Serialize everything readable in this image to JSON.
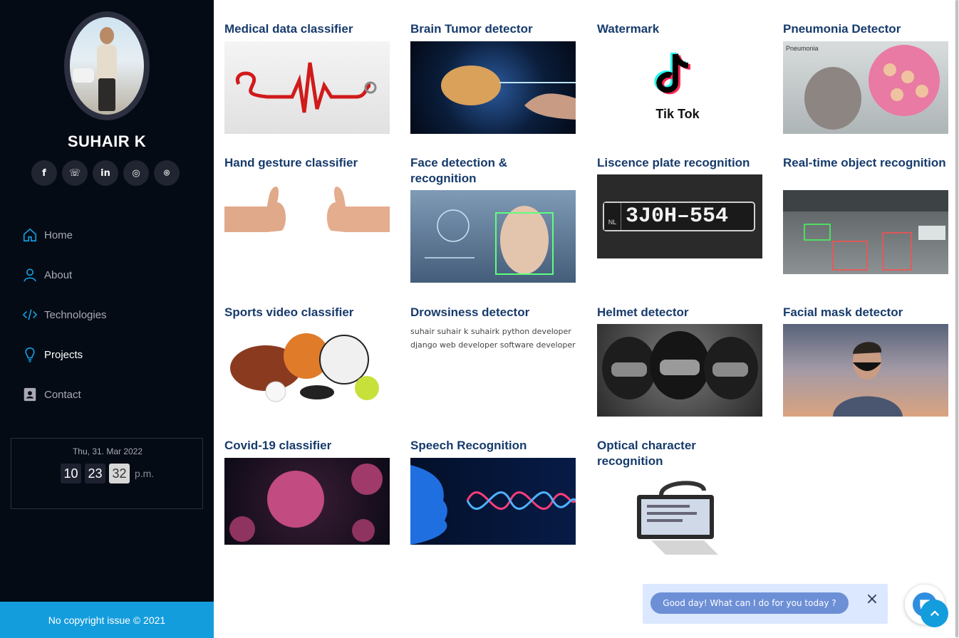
{
  "profile": {
    "name": "SUHAIR K"
  },
  "socials": [
    {
      "icon": "facebook-icon",
      "glyph": "f"
    },
    {
      "icon": "whatsapp-icon",
      "glyph": "☏"
    },
    {
      "icon": "linkedin-icon",
      "glyph": "in"
    },
    {
      "icon": "instagram-icon",
      "glyph": "◎"
    },
    {
      "icon": "github-icon",
      "glyph": "⌾"
    }
  ],
  "nav": [
    {
      "label": "Home",
      "icon": "home-icon"
    },
    {
      "label": "About",
      "icon": "user-icon"
    },
    {
      "label": "Technologies",
      "icon": "code-icon"
    },
    {
      "label": "Projects",
      "icon": "lightbulb-icon",
      "active": true
    },
    {
      "label": "Contact",
      "icon": "contact-card-icon"
    }
  ],
  "clock": {
    "date": "Thu, 31. Mar 2022",
    "hour": "10",
    "minute": "23",
    "second": "32",
    "ampm": "p.m."
  },
  "footer": "No copyright issue © 2021",
  "projects": [
    {
      "title": "Medical data classifier"
    },
    {
      "title": "Brain Tumor detector"
    },
    {
      "title": "Watermark",
      "image_text": "Tik Tok"
    },
    {
      "title": "Pneumonia Detector",
      "image_text": "Pneumonia"
    },
    {
      "title": "Hand gesture classifier"
    },
    {
      "title": "Face detection & recognition"
    },
    {
      "title": "Liscence plate recognition",
      "image_text": "3J0H–554",
      "country": "NL"
    },
    {
      "title": "Real-time object recognition"
    },
    {
      "title": "Sports video classifier"
    },
    {
      "title": "Drowsiness detector",
      "alt_text": "suhair suhair k suhairk python developer django web developer software developer"
    },
    {
      "title": "Helmet detector"
    },
    {
      "title": "Facial mask detector"
    },
    {
      "title": "Covid-19 classifier"
    },
    {
      "title": "Speech Recognition"
    },
    {
      "title": "Optical character recognition"
    }
  ],
  "chat": {
    "message": "Good day! What can I do for you today ?",
    "close": "×"
  },
  "colors": {
    "sidebar": "#040b14",
    "accent": "#149ddd",
    "heading": "#173b6c"
  }
}
